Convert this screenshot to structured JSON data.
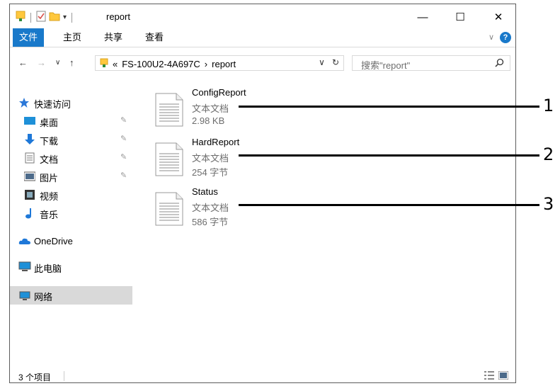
{
  "window": {
    "title": "report",
    "controls": {
      "minimize": "—",
      "maximize": "☐",
      "close": "✕"
    }
  },
  "ribbon": {
    "tabs": [
      {
        "label": "文件",
        "active": true
      },
      {
        "label": "主页",
        "active": false
      },
      {
        "label": "共享",
        "active": false
      },
      {
        "label": "查看",
        "active": false
      }
    ],
    "help": "?"
  },
  "address": {
    "overflow": "«",
    "path": [
      "FS-100U2-4A697C",
      "report"
    ],
    "separator": "›"
  },
  "search": {
    "placeholder": "搜索\"report\""
  },
  "nav": {
    "quick_access": "快速访问",
    "items": [
      {
        "label": "桌面",
        "icon": "desktop-icon",
        "pinned": true
      },
      {
        "label": "下载",
        "icon": "download-icon",
        "pinned": true
      },
      {
        "label": "文档",
        "icon": "documents-icon",
        "pinned": true
      },
      {
        "label": "图片",
        "icon": "pictures-icon",
        "pinned": true
      },
      {
        "label": "视频",
        "icon": "videos-icon",
        "pinned": false
      },
      {
        "label": "音乐",
        "icon": "music-icon",
        "pinned": false
      }
    ],
    "onedrive": "OneDrive",
    "this_pc": "此电脑",
    "network": "网络"
  },
  "files": [
    {
      "name": "ConfigReport",
      "type": "文本文档",
      "size": "2.98 KB"
    },
    {
      "name": "HardReport",
      "type": "文本文档",
      "size": "254 字节"
    },
    {
      "name": "Status",
      "type": "文本文档",
      "size": "586 字节"
    }
  ],
  "callouts": [
    "1",
    "2",
    "3"
  ],
  "status": {
    "count": "3 个项目"
  },
  "colors": {
    "accent": "#1979ca",
    "selected": "#d9d9d9",
    "folder": "#ffc83d"
  }
}
